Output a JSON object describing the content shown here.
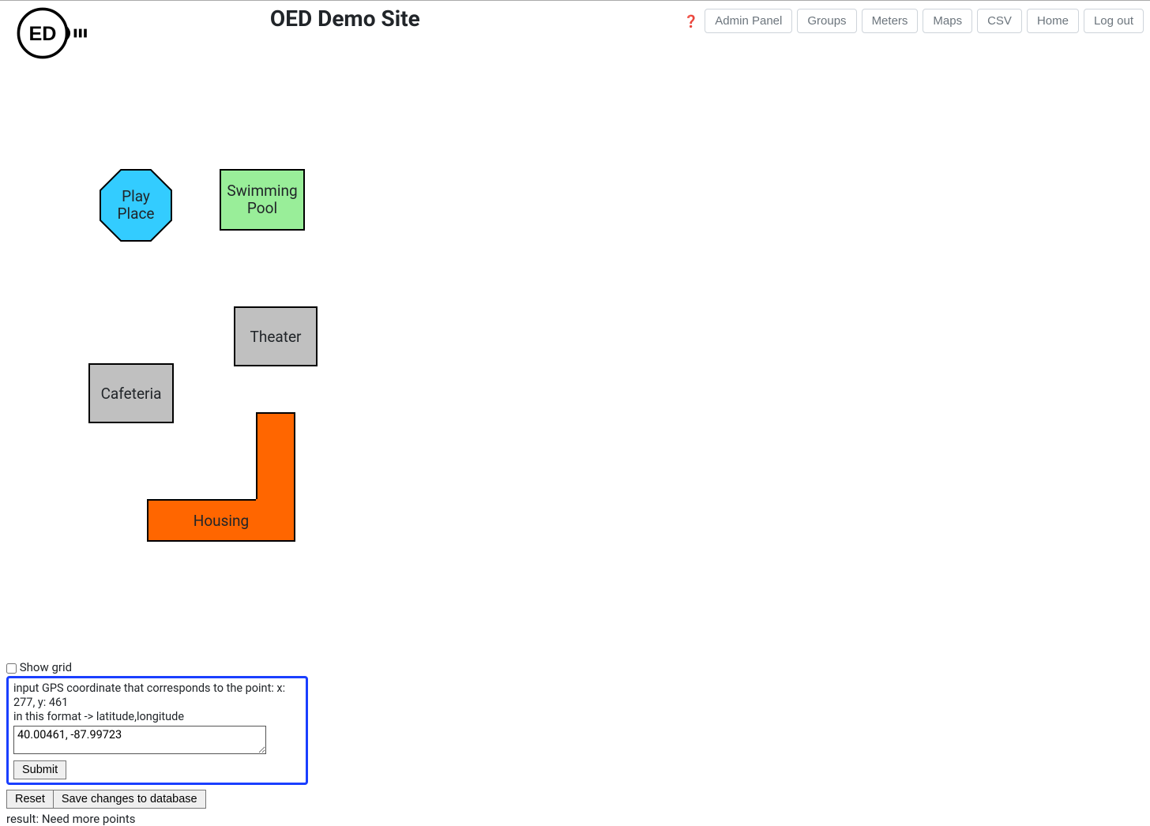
{
  "header": {
    "title": "OED Demo Site",
    "nav": {
      "admin": "Admin Panel",
      "groups": "Groups",
      "meters": "Meters",
      "maps": "Maps",
      "csv": "CSV",
      "home": "Home",
      "logout": "Log out"
    }
  },
  "map": {
    "buildings": {
      "play_place": "Play\nPlace",
      "swimming_pool": "Swimming\nPool",
      "theater": "Theater",
      "cafeteria": "Cafeteria",
      "housing": "Housing"
    }
  },
  "controls": {
    "show_grid_label": "Show grid",
    "gps_prompt_line1": "input GPS coordinate that corresponds to the point: x: 277, y: 461",
    "gps_prompt_line2": "in this format -> latitude,longitude",
    "gps_value": "40.00461, -87.99723",
    "submit_label": "Submit",
    "reset_label": "Reset",
    "save_label": "Save changes to database",
    "result_text": "result: Need more points"
  }
}
